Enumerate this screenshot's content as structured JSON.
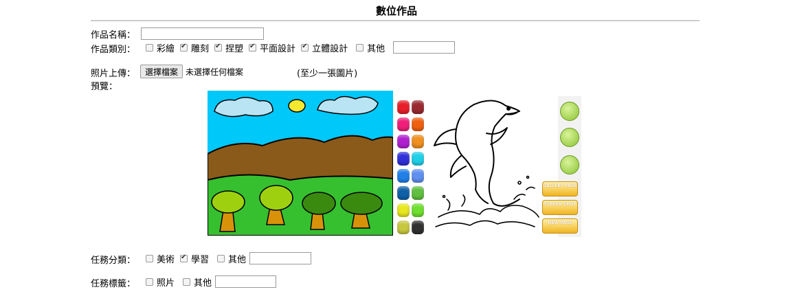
{
  "page": {
    "title": "數位作品"
  },
  "form": {
    "name_label": "作品名稱：",
    "name_value": "",
    "category_label": "作品類別：",
    "categories": [
      {
        "label": "彩繪",
        "checked": false
      },
      {
        "label": "雕刻",
        "checked": true
      },
      {
        "label": "捏塑",
        "checked": true
      },
      {
        "label": "平面設計",
        "checked": true
      },
      {
        "label": "立體設計",
        "checked": true
      },
      {
        "label": "其他",
        "checked": false
      }
    ],
    "category_other_value": "",
    "upload_label": "照片上傳：",
    "upload_button": "選擇檔案",
    "upload_status": "未選擇任何檔案",
    "upload_hint": "(至少一張圖片)",
    "preview_label": "預覽：",
    "task_category_label": "任務分類：",
    "task_categories": [
      {
        "label": "美術",
        "checked": false
      },
      {
        "label": "學習",
        "checked": true
      },
      {
        "label": "其他",
        "checked": false
      }
    ],
    "task_category_other_value": "",
    "task_tag_label": "任務標籤：",
    "task_tags": [
      {
        "label": "照片",
        "checked": false
      },
      {
        "label": "其他",
        "checked": false
      }
    ],
    "task_tag_other_value": ""
  },
  "preview": {
    "palette_colors": [
      "#e8202a",
      "#9a2a30",
      "#f0207a",
      "#f06010",
      "#b020d0",
      "#f09020",
      "#3030d8",
      "#20d0e8",
      "#2080e8",
      "#6090f0",
      "#1060a8",
      "#60c040",
      "#e8e820",
      "#70e030",
      "#c8c840",
      "#303030"
    ],
    "side_buttons": [
      {
        "label": "GALLERY PAGE"
      },
      {
        "label": "SCREEN SHOT"
      },
      {
        "label": "NEW PAGE"
      }
    ],
    "tool_icons": [
      "paintbrush-icon",
      "trash-icon",
      "eraser-icon"
    ]
  }
}
